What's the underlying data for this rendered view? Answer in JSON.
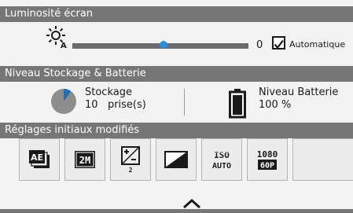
{
  "brightness_section": {
    "header": "Luminosité écran",
    "icon": "brightness-auto-icon",
    "value": "0",
    "level_fraction": 0.52,
    "auto_checked": true,
    "auto_label": "Automatique"
  },
  "storage_section": {
    "header": "Niveau Stockage & Batterie",
    "storage_icon": "storage-pie-icon",
    "storage_title": "Stockage",
    "storage_count": "10   prise(s)",
    "storage_used_fraction": 0.1,
    "battery_icon": "battery-full-icon",
    "battery_title": "Niveau Batterie",
    "battery_level": "100 %"
  },
  "settings_section": {
    "header": "Réglages initiaux modifiés",
    "tiles": [
      {
        "icon": "ae-bracketing-icon",
        "label": "AE"
      },
      {
        "icon": "image-size-2m-icon",
        "label": "2M"
      },
      {
        "icon": "exposure-compensation-icon",
        "label": "2"
      },
      {
        "icon": "contrast-icon",
        "label": ""
      },
      {
        "icon": "iso-auto-icon",
        "label_top": "ISO",
        "label_bottom": "AUTO"
      },
      {
        "icon": "video-1080-60p-icon",
        "label_top": "1080",
        "label_bottom": "60P"
      }
    ],
    "expand_icon": "chevron-up-icon"
  },
  "colors": {
    "header_bg": "#767676",
    "accent": "#2a8fd8",
    "background": "#f3f3f3"
  }
}
